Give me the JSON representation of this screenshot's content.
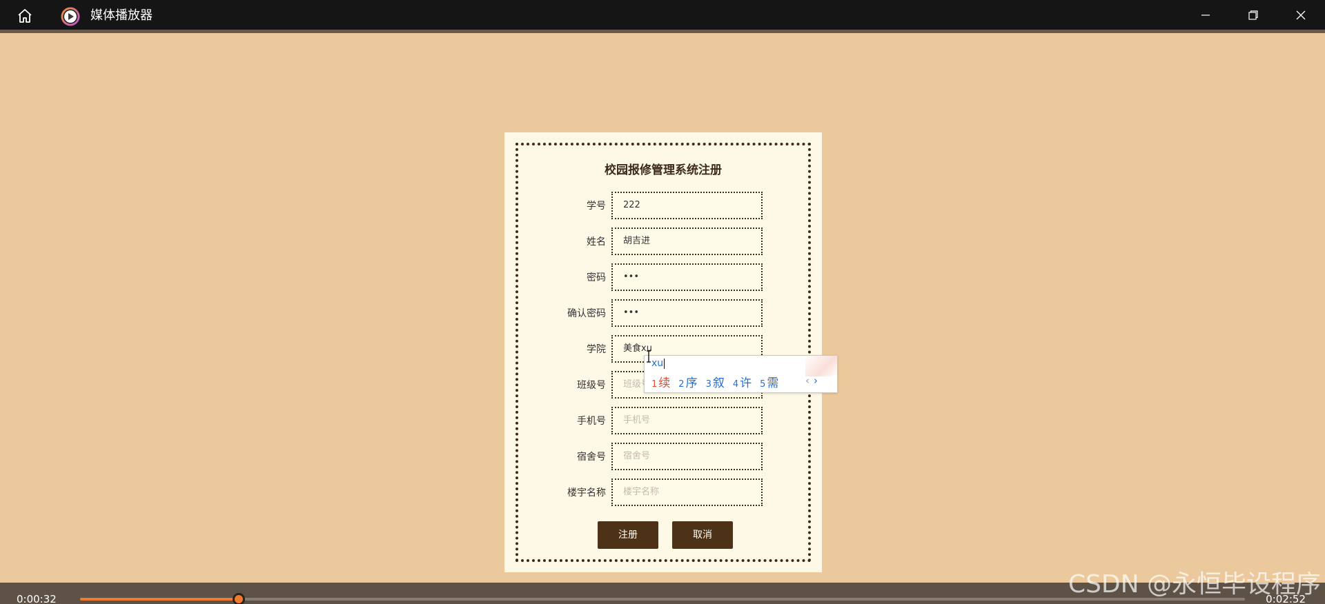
{
  "window": {
    "title": "媒体播放器",
    "icons": {
      "home": "home-icon",
      "app": "play-circle-icon",
      "minimize": "minimize-icon",
      "maximize": "restore-icon",
      "close": "close-icon"
    }
  },
  "form": {
    "title": "校园报修管理系统注册",
    "fields": [
      {
        "label": "学号",
        "value": "222",
        "placeholder": ""
      },
      {
        "label": "姓名",
        "value": "胡吉进",
        "placeholder": ""
      },
      {
        "label": "密码",
        "value": "•••",
        "placeholder": ""
      },
      {
        "label": "确认密码",
        "value": "•••",
        "placeholder": ""
      },
      {
        "label": "学院",
        "value": "美食xu",
        "placeholder": ""
      },
      {
        "label": "班级号",
        "value": "",
        "placeholder": "班级号"
      },
      {
        "label": "手机号",
        "value": "",
        "placeholder": "手机号"
      },
      {
        "label": "宿舍号",
        "value": "",
        "placeholder": "宿舍号"
      },
      {
        "label": "楼宇名称",
        "value": "",
        "placeholder": "楼宇名称"
      }
    ],
    "submit_label": "注册",
    "cancel_label": "取消"
  },
  "ime": {
    "composition": "xu",
    "candidates": [
      {
        "num": "1",
        "text": "续"
      },
      {
        "num": "2",
        "text": "序"
      },
      {
        "num": "3",
        "text": "叙"
      },
      {
        "num": "4",
        "text": "许"
      },
      {
        "num": "5",
        "text": "需"
      }
    ],
    "prev": "‹",
    "next": "›"
  },
  "player": {
    "current_time": "0:00:32",
    "total_time": "0:02:52",
    "progress_fraction": 0.136
  },
  "watermark": "CSDN @永恒毕设程序",
  "colors": {
    "accent": "#f07a30",
    "button": "#4e3217",
    "background": "#ebc99c"
  }
}
